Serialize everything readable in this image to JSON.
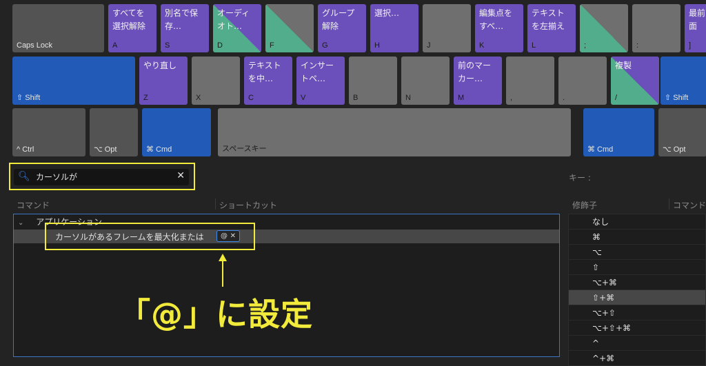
{
  "keyboard": {
    "row1": [
      {
        "key": "Caps Lock",
        "command": "",
        "style": "dark"
      },
      {
        "key": "A",
        "command": "すべてを\n選択解除",
        "style": "purple"
      },
      {
        "key": "S",
        "command": "別名で保\n存…",
        "style": "purple"
      },
      {
        "key": "D",
        "command": "オーディ\nオト…",
        "style": "split-purple"
      },
      {
        "key": "F",
        "command": "",
        "style": "split"
      },
      {
        "key": "G",
        "command": "グループ\n解除",
        "style": "purple"
      },
      {
        "key": "H",
        "command": "選択…",
        "style": "purple"
      },
      {
        "key": "J",
        "command": "",
        "style": "gray"
      },
      {
        "key": "K",
        "command": "編集点を\nすべ…",
        "style": "purple"
      },
      {
        "key": "L",
        "command": "テキスト\nを左揃え",
        "style": "purple"
      },
      {
        "key": ";",
        "command": "",
        "style": "split"
      },
      {
        "key": ":",
        "command": "",
        "style": "gray"
      },
      {
        "key": "]",
        "command": "最前面",
        "style": "purple"
      }
    ],
    "row2": [
      {
        "key": "⇧ Shift",
        "command": "",
        "style": "blue"
      },
      {
        "key": "Z",
        "command": "やり直し",
        "style": "purple"
      },
      {
        "key": "X",
        "command": "",
        "style": "gray"
      },
      {
        "key": "C",
        "command": "テキスト\nを中…",
        "style": "purple"
      },
      {
        "key": "V",
        "command": "インサー\nトペ…",
        "style": "purple"
      },
      {
        "key": "B",
        "command": "",
        "style": "gray"
      },
      {
        "key": "N",
        "command": "",
        "style": "gray"
      },
      {
        "key": "M",
        "command": "前のマー\nカー…",
        "style": "purple"
      },
      {
        "key": ",",
        "command": "",
        "style": "gray"
      },
      {
        "key": ".",
        "command": "",
        "style": "gray"
      },
      {
        "key": "/",
        "command": "複製",
        "style": "split-purple"
      },
      {
        "key": "⇧ Shift",
        "command": "",
        "style": "blue"
      }
    ],
    "row3": [
      {
        "key": "^ Ctrl",
        "command": "",
        "style": "dark"
      },
      {
        "key": "⌥ Opt",
        "command": "",
        "style": "dark"
      },
      {
        "key": "⌘ Cmd",
        "command": "",
        "style": "blue"
      },
      {
        "key": "スペースキー",
        "command": "",
        "style": "gray"
      },
      {
        "key": "⌘ Cmd",
        "command": "",
        "style": "blue"
      },
      {
        "key": "⌥ Opt",
        "command": "",
        "style": "dark"
      }
    ]
  },
  "search": {
    "value": "カーソルが",
    "icon": "search-icon",
    "clear_icon": "close-icon"
  },
  "key_label": "キー :",
  "columns": {
    "command": "コマンド",
    "shortcut": "ショートカット",
    "modifier": "修飾子",
    "command2": "コマンド"
  },
  "commands": {
    "group": "アプリケーション",
    "rows": [
      {
        "name": "カーソルがあるフレームを最大化または",
        "shortcut": "@"
      }
    ]
  },
  "modifiers": [
    {
      "label": "なし",
      "selected": false
    },
    {
      "label": "⌘",
      "selected": false
    },
    {
      "label": "⌥",
      "selected": false
    },
    {
      "label": "⇧",
      "selected": false
    },
    {
      "label": "⌥+⌘",
      "selected": false
    },
    {
      "label": "⇧+⌘",
      "selected": true
    },
    {
      "label": "⌥+⇧",
      "selected": false
    },
    {
      "label": "⌥+⇧+⌘",
      "selected": false
    },
    {
      "label": "^",
      "selected": false
    },
    {
      "label": "^+⌘",
      "selected": false
    }
  ],
  "annotation": "「@」に設定",
  "colors": {
    "highlight": "#f2eb3b",
    "purple": "#6b4fbb",
    "green": "#52ad8c",
    "blue": "#215bb7"
  }
}
